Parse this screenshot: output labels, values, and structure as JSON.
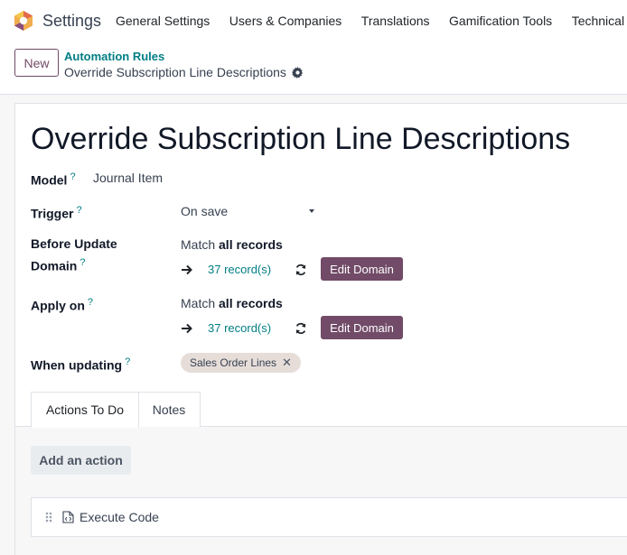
{
  "navbar": {
    "app_name": "Settings",
    "menu": [
      "General Settings",
      "Users & Companies",
      "Translations",
      "Gamification Tools",
      "Technical"
    ]
  },
  "control_panel": {
    "new_label": "New",
    "breadcrumb_parent": "Automation Rules",
    "breadcrumb_current": "Override Subscription Line Descriptions"
  },
  "form": {
    "title": "Override Subscription Line Descriptions",
    "model_label": "Model",
    "model_value": "Journal Item",
    "trigger_label": "Trigger",
    "trigger_value": "On save",
    "before_update_label_line1": "Before Update",
    "before_update_label_line2": "Domain",
    "before_match_prefix": "Match",
    "before_match_bold": "all records",
    "before_records": "37 record(s)",
    "edit_domain_label": "Edit Domain",
    "apply_on_label": "Apply on",
    "apply_match_prefix": "Match",
    "apply_match_bold": "all records",
    "apply_records": "37 record(s)",
    "when_updating_label": "When updating",
    "when_updating_tag": "Sales Order Lines",
    "help_mark": "?"
  },
  "tabs": {
    "actions_label": "Actions To Do",
    "notes_label": "Notes"
  },
  "actions": {
    "add_label": "Add an action",
    "items": [
      {
        "label": "Execute Code"
      }
    ]
  },
  "colors": {
    "brand": "#714b67",
    "link": "#017e84",
    "tag_bg": "#e6ddd9"
  },
  "icons": [
    "odoo-logo-icon",
    "gear-icon",
    "arrow-right-icon",
    "refresh-icon",
    "close-icon",
    "drag-handle-icon",
    "code-file-icon",
    "caret-down-icon"
  ]
}
